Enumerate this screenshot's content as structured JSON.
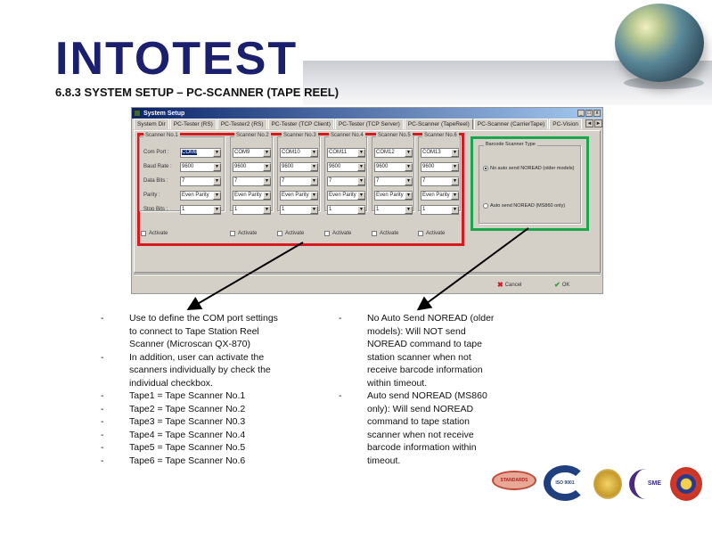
{
  "header": {
    "brand": "INTOTEST",
    "title": "6.8.3 SYSTEM SETUP – PC-SCANNER (TAPE REEL)",
    "decor": "globe-icon"
  },
  "window": {
    "title": "System Setup",
    "controls": [
      "_",
      "□",
      "x"
    ],
    "tabs": [
      {
        "label": "System Dir",
        "active": false
      },
      {
        "label": "PC-Tester (RS)",
        "active": false
      },
      {
        "label": "PC-Tester2 (RS)",
        "active": false
      },
      {
        "label": "PC-Tester (TCP Client)",
        "active": false
      },
      {
        "label": "PC-Tester (TCP Server)",
        "active": false
      },
      {
        "label": "PC-Scanner (TapeReel)",
        "active": true
      },
      {
        "label": "PC-Scanner (CarrierTape)",
        "active": false
      },
      {
        "label": "PC-Vision",
        "active": false
      }
    ],
    "tab_scroll": [
      "◄",
      "►"
    ],
    "row_labels": [
      "Com Port :",
      "Baud Rate :",
      "Data Bits :",
      "Parity :",
      "Stop Bits :"
    ],
    "scanners": [
      {
        "title": "Scanner No.1",
        "com_port": "COM8",
        "baud_rate": "9600",
        "data_bits": "7",
        "parity": "Even Parity",
        "stop_bits": "1",
        "activate_label": "Activate",
        "activated": false
      },
      {
        "title": "Scanner No.2",
        "com_port": "COM9",
        "baud_rate": "9600",
        "data_bits": "7",
        "parity": "Even Parity",
        "stop_bits": "1",
        "activate_label": "Activate",
        "activated": false
      },
      {
        "title": "Scanner No.3",
        "com_port": "COM10",
        "baud_rate": "9600",
        "data_bits": "7",
        "parity": "Even Parity",
        "stop_bits": "1",
        "activate_label": "Activate",
        "activated": false
      },
      {
        "title": "Scanner No.4",
        "com_port": "COM11",
        "baud_rate": "9600",
        "data_bits": "7",
        "parity": "Even Parity",
        "stop_bits": "1",
        "activate_label": "Activate",
        "activated": false
      },
      {
        "title": "Scanner No.5",
        "com_port": "COM12",
        "baud_rate": "9600",
        "data_bits": "7",
        "parity": "Even Parity",
        "stop_bits": "1",
        "activate_label": "Activate",
        "activated": false
      },
      {
        "title": "Scanner No.6",
        "com_port": "COM13",
        "baud_rate": "9600",
        "data_bits": "7",
        "parity": "Even Parity",
        "stop_bits": "1",
        "activate_label": "Activate",
        "activated": false
      }
    ],
    "barcode_scanner_type": {
      "title": "Barcode Scanner Type",
      "options": [
        {
          "label": "No auto send NOREAD (older models)",
          "selected": true
        },
        {
          "label": "Auto send NOREAD (MS860 only)",
          "selected": false
        }
      ]
    },
    "cancel_label": "Cancel",
    "ok_label": "OK",
    "highlight_colors": {
      "scanner_settings": "#d71920",
      "barcode_type": "#1aa64a"
    }
  },
  "notes": {
    "left": [
      "Use to define the COM port settings to connect to Tape Station Reel Scanner (Microscan QX-870)",
      "In addition, user can activate the scanners individually by check the individual checkbox.",
      "Tape1 = Tape Scanner No.1",
      "Tape2 = Tape Scanner No.2",
      "Tape3 = Tape Scanner N0.3",
      "Tape4 = Tape Scanner No.4",
      "Tape5 = Tape Scanner No.5",
      "Tape6 = Tape Scanner No.6"
    ],
    "right": [
      "No Auto Send NOREAD (older models): Will NOT send NOREAD command to tape station scanner when not receive barcode information within timeout.",
      "Auto send NOREAD (MS860 only): Will send NOREAD command to tape station scanner when not receive barcode information within timeout."
    ],
    "bullet": "-"
  },
  "certifications": {
    "standards_logo": "STANDARDS",
    "iso_logo": "ISO 9001",
    "sme_logo": "SME"
  }
}
